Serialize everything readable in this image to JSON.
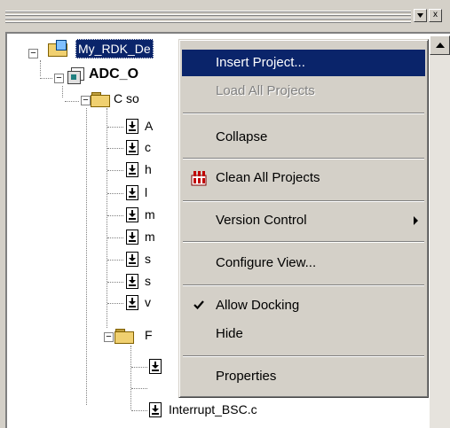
{
  "tree": {
    "workspace": "My_RDK_De",
    "project": "ADC_O",
    "folder_c": "C so",
    "partials": [
      "A",
      "c",
      "h",
      "l",
      "m",
      "m",
      "s",
      "s",
      "v"
    ],
    "folder_f": "F",
    "bottom_files": [
      "Interrupt_BSC.c"
    ]
  },
  "menu": {
    "items": {
      "insert_project": "Insert Project...",
      "load_all_projects": "Load All Projects",
      "collapse": "Collapse",
      "clean_all_projects": "Clean All Projects",
      "version_control": "Version Control",
      "configure_view": "Configure View...",
      "allow_docking": "Allow Docking",
      "hide": "Hide",
      "properties": "Properties"
    }
  },
  "toolbar": {
    "close_glyph": "x"
  },
  "colors": {
    "highlight": "#0a246a",
    "face": "#d4d0c8",
    "disabled": "#808080"
  }
}
